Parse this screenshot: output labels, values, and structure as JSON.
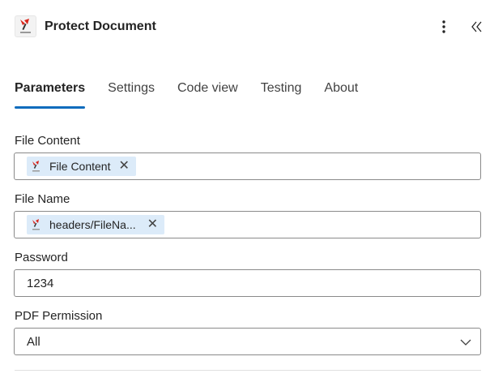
{
  "header": {
    "title": "Protect Document",
    "logo_icon": "api-key-logo-icon",
    "more_icon": "more-vertical-icon",
    "collapse_icon": "double-chevron-left-icon"
  },
  "tabs": [
    {
      "label": "Parameters",
      "active": true
    },
    {
      "label": "Settings",
      "active": false
    },
    {
      "label": "Code view",
      "active": false
    },
    {
      "label": "Testing",
      "active": false
    },
    {
      "label": "About",
      "active": false
    }
  ],
  "fields": {
    "file_content": {
      "label": "File Content",
      "token": "File Content",
      "remove_glyph": "✕"
    },
    "file_name": {
      "label": "File Name",
      "token": "headers/FileNa...",
      "remove_glyph": "✕"
    },
    "password": {
      "label": "Password",
      "value": "1234"
    },
    "pdf_permission": {
      "label": "PDF Permission",
      "selected": "All"
    }
  },
  "colors": {
    "accent": "#0f6cbd",
    "token_bg": "#dcebf9",
    "logo_red": "#d9261c"
  }
}
